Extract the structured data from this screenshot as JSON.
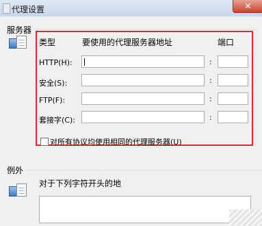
{
  "window": {
    "title": "代理设置",
    "close_glyph": "✕"
  },
  "servers": {
    "group_label": "服务器",
    "col_type": "类型",
    "col_address": "要使用的代理服务器地址",
    "col_port": "端口",
    "rows": [
      {
        "label": "HTTP(H):",
        "address": "",
        "port": ""
      },
      {
        "label": "安全(S):",
        "address": "",
        "port": ""
      },
      {
        "label": "FTP(F):",
        "address": "",
        "port": ""
      },
      {
        "label": "套接字(C):",
        "address": "",
        "port": ""
      }
    ],
    "colon": ":",
    "same_proxy_label": "对所有协议均使用相同的代理服务器(U)",
    "same_proxy_checked": false
  },
  "exceptions": {
    "group_label": "例外",
    "description": "对于下列字符开头的地",
    "value": ""
  },
  "colors": {
    "highlight_frame": "#e0262f",
    "window_bg": "#f0f0f0"
  }
}
